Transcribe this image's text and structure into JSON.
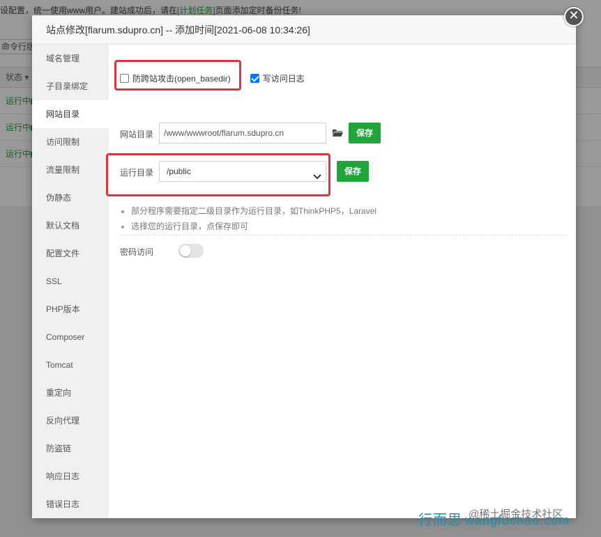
{
  "background": {
    "notice_prefix": "设配置，统一使用www用户。建站成功后，请在",
    "notice_link": "[计划任务]",
    "notice_suffix": "页面添加定时备份任务!",
    "toolbar_text": "命令行版本",
    "table_head": "状态 ▾",
    "rows": [
      "运行中▶",
      "运行中▶",
      "运行中▶"
    ]
  },
  "dialog": {
    "title": "站点修改[flarum.sdupro.cn] -- 添加时间[2021-06-08 10:34:26]",
    "close_icon": "✕"
  },
  "sidebar": {
    "items": [
      {
        "label": "域名管理"
      },
      {
        "label": "子目录绑定"
      },
      {
        "label": "网站目录"
      },
      {
        "label": "访问限制"
      },
      {
        "label": "流量限制"
      },
      {
        "label": "伪静态"
      },
      {
        "label": "默认文档"
      },
      {
        "label": "配置文件"
      },
      {
        "label": "SSL"
      },
      {
        "label": "PHP版本"
      },
      {
        "label": "Composer"
      },
      {
        "label": "Tomcat"
      },
      {
        "label": "重定向"
      },
      {
        "label": "反向代理"
      },
      {
        "label": "防盗链"
      },
      {
        "label": "响应日志"
      },
      {
        "label": "错误日志"
      }
    ],
    "active_index": 2
  },
  "options": {
    "open_basedir_label": "防跨站攻击(open_basedir)",
    "open_basedir_checked": false,
    "access_log_label": "写访问日志",
    "access_log_checked": true
  },
  "site_dir": {
    "label": "网站目录",
    "value": "/www/wwwroot/flarum.sdupro.cn",
    "folder_icon": "folder-open-icon",
    "save_label": "保存"
  },
  "run_dir": {
    "label": "运行目录",
    "selected": "/public",
    "save_label": "保存"
  },
  "tips": [
    "部分程序需要指定二级目录作为运行目录，如ThinkPHP5，Laravel",
    "选择您的运行目录，点保存即可"
  ],
  "password_access": {
    "label": "密码访问",
    "enabled": false
  },
  "watermark": {
    "text1": "行而思",
    "text2": "@稀土掘金技术社区",
    "text3": "wangfuchao.com"
  },
  "colors": {
    "accent": "#20a53a",
    "highlight": "#d9363e",
    "checkbox_checked": "#0075ff"
  }
}
